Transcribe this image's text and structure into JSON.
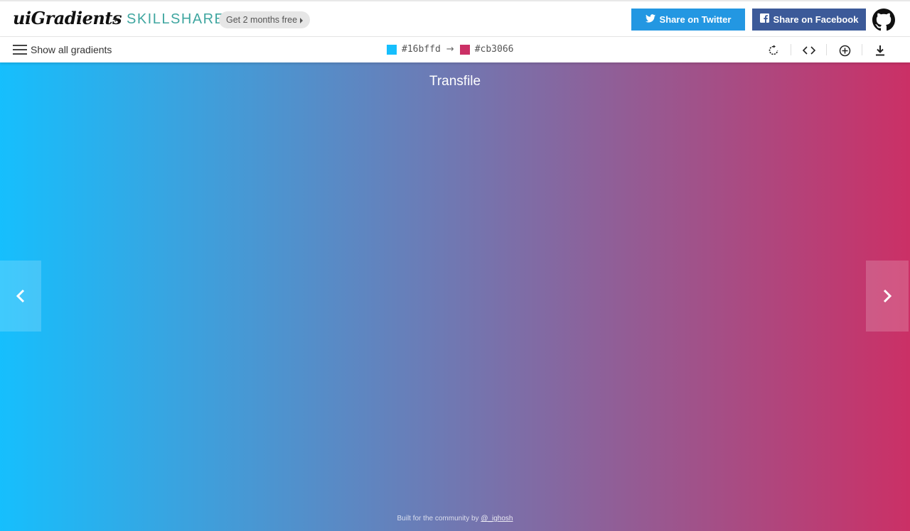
{
  "header": {
    "logo": "uiGradients",
    "plus": "+",
    "partner": "SKILLSHARE",
    "promo": "Get 2 months free",
    "share_twitter": "Share on Twitter",
    "share_facebook": "Share on Facebook",
    "github_icon": "github-icon"
  },
  "toolbar": {
    "menu_label": "Show all gradients",
    "color_from": "#16bffd",
    "color_to": "#cb3066",
    "arrow": "→",
    "icons": [
      "rotate-icon",
      "code-icon",
      "add-icon",
      "download-icon"
    ]
  },
  "gradient": {
    "name": "Transfile",
    "direction": "to right"
  },
  "footer": {
    "text": "Built for the community by",
    "author": "@_ighosh"
  },
  "colors": {
    "twitter": "#2397e2",
    "facebook": "#3c5a99",
    "skillshare": "#3fa6a0"
  }
}
